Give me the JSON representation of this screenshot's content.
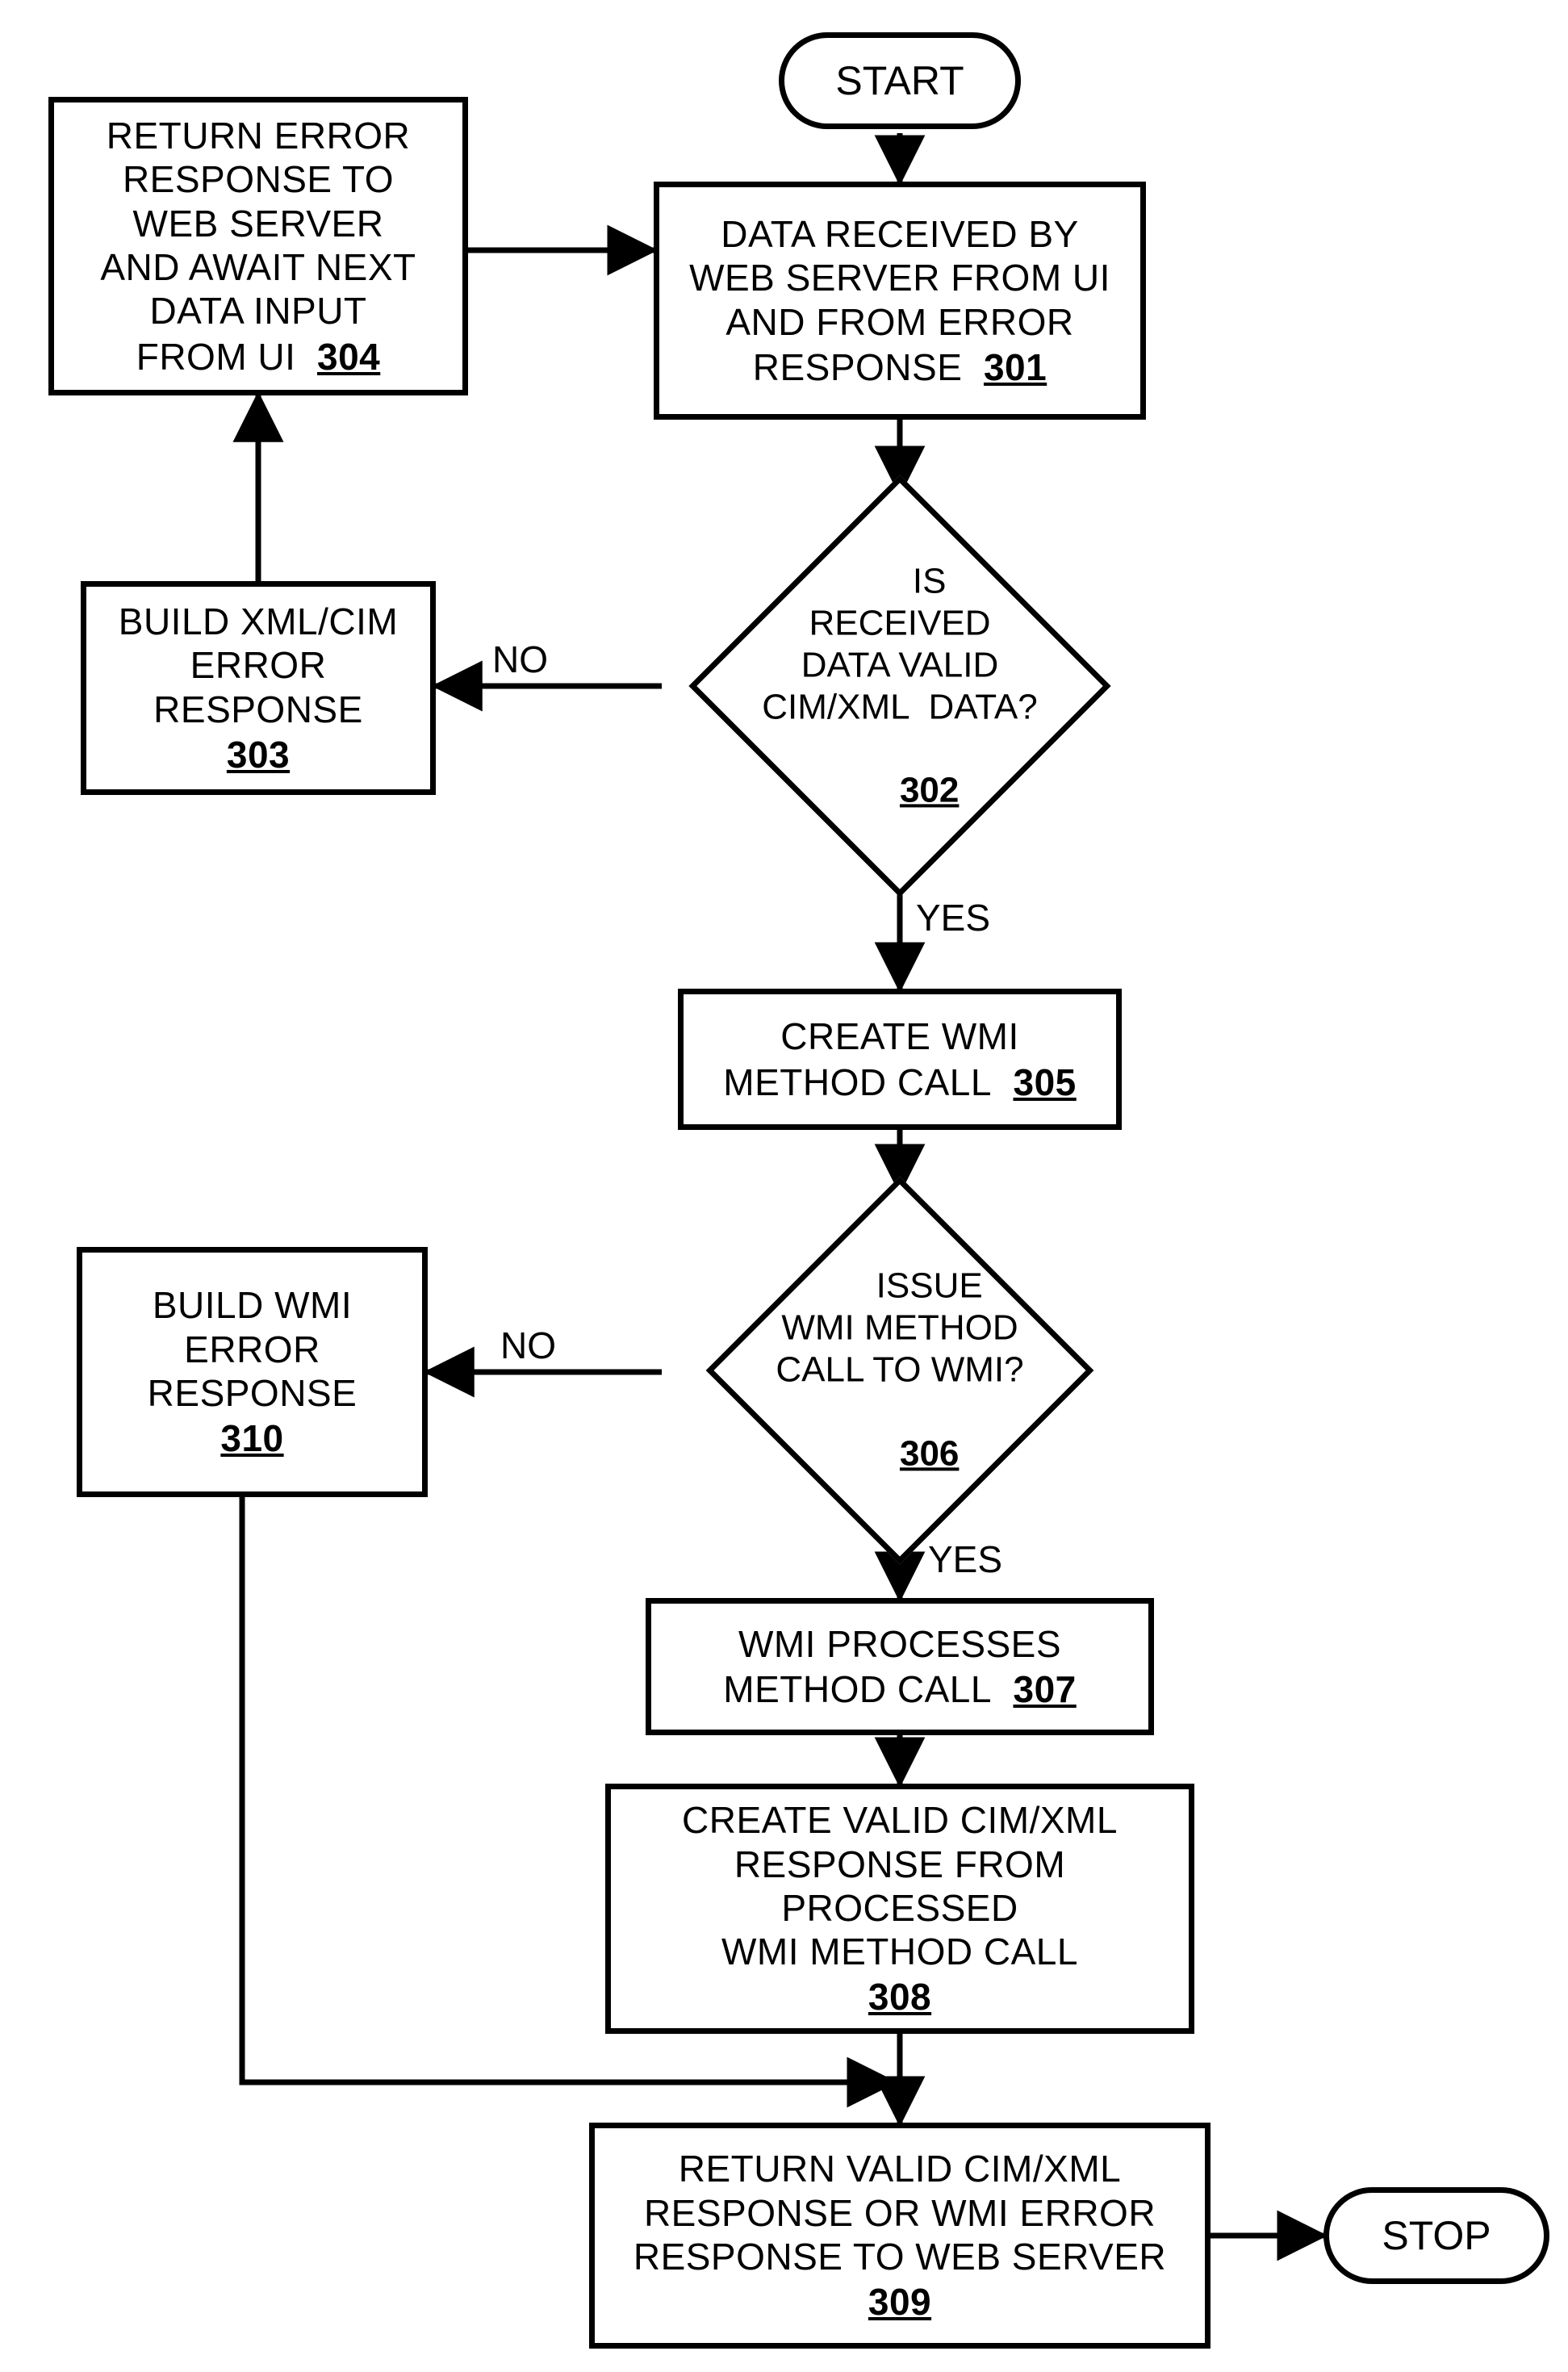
{
  "nodes": {
    "start": {
      "label": "START"
    },
    "stop": {
      "label": "STOP"
    },
    "n301": {
      "text": "DATA RECEIVED BY\nWEB SERVER FROM UI\nAND FROM ERROR\nRESPONSE",
      "ref": "301"
    },
    "n302": {
      "text": "IS\nRECEIVED\nDATA VALID\nCIM/XML  DATA?",
      "ref": "302"
    },
    "n303": {
      "text": "BUILD XML/CIM\nERROR\nRESPONSE",
      "ref": "303"
    },
    "n304": {
      "text": "RETURN ERROR\nRESPONSE TO\nWEB SERVER\nAND AWAIT NEXT\nDATA INPUT\nFROM UI",
      "ref": "304"
    },
    "n305": {
      "text": "CREATE WMI\nMETHOD CALL",
      "ref": "305"
    },
    "n306": {
      "text": "ISSUE\nWMI METHOD\nCALL TO WMI?",
      "ref": "306"
    },
    "n307": {
      "text": "WMI PROCESSES\nMETHOD CALL",
      "ref": "307"
    },
    "n308": {
      "text": "CREATE VALID CIM/XML\nRESPONSE FROM\nPROCESSED\nWMI METHOD CALL",
      "ref": "308"
    },
    "n309": {
      "text": "RETURN VALID CIM/XML\nRESPONSE OR WMI ERROR\nRESPONSE TO WEB SERVER",
      "ref": "309"
    },
    "n310": {
      "text": "BUILD WMI\nERROR\nRESPONSE",
      "ref": "310"
    }
  },
  "edge_labels": {
    "d302_no": "NO",
    "d302_yes": "YES",
    "d306_no": "NO",
    "d306_yes": "YES"
  },
  "chart_data": {
    "type": "flowchart",
    "nodes": [
      {
        "id": "start",
        "shape": "terminal",
        "label": "START"
      },
      {
        "id": "301",
        "shape": "process",
        "label": "DATA RECEIVED BY WEB SERVER FROM UI AND FROM ERROR RESPONSE"
      },
      {
        "id": "302",
        "shape": "decision",
        "label": "IS RECEIVED DATA VALID CIM/XML DATA?"
      },
      {
        "id": "303",
        "shape": "process",
        "label": "BUILD XML/CIM ERROR RESPONSE"
      },
      {
        "id": "304",
        "shape": "process",
        "label": "RETURN ERROR RESPONSE TO WEB SERVER AND AWAIT NEXT DATA INPUT FROM UI"
      },
      {
        "id": "305",
        "shape": "process",
        "label": "CREATE WMI METHOD CALL"
      },
      {
        "id": "306",
        "shape": "decision",
        "label": "ISSUE WMI METHOD CALL TO WMI?"
      },
      {
        "id": "307",
        "shape": "process",
        "label": "WMI PROCESSES METHOD CALL"
      },
      {
        "id": "308",
        "shape": "process",
        "label": "CREATE VALID CIM/XML RESPONSE FROM PROCESSED WMI METHOD CALL"
      },
      {
        "id": "309",
        "shape": "process",
        "label": "RETURN VALID CIM/XML RESPONSE OR WMI ERROR RESPONSE TO WEB SERVER"
      },
      {
        "id": "310",
        "shape": "process",
        "label": "BUILD WMI ERROR RESPONSE"
      },
      {
        "id": "stop",
        "shape": "terminal",
        "label": "STOP"
      }
    ],
    "edges": [
      {
        "from": "start",
        "to": "301"
      },
      {
        "from": "301",
        "to": "302"
      },
      {
        "from": "302",
        "to": "303",
        "label": "NO"
      },
      {
        "from": "302",
        "to": "305",
        "label": "YES"
      },
      {
        "from": "303",
        "to": "304"
      },
      {
        "from": "304",
        "to": "301"
      },
      {
        "from": "305",
        "to": "306"
      },
      {
        "from": "306",
        "to": "310",
        "label": "NO"
      },
      {
        "from": "306",
        "to": "307",
        "label": "YES"
      },
      {
        "from": "307",
        "to": "308"
      },
      {
        "from": "308",
        "to": "309"
      },
      {
        "from": "310",
        "to": "309"
      },
      {
        "from": "309",
        "to": "stop"
      }
    ]
  }
}
